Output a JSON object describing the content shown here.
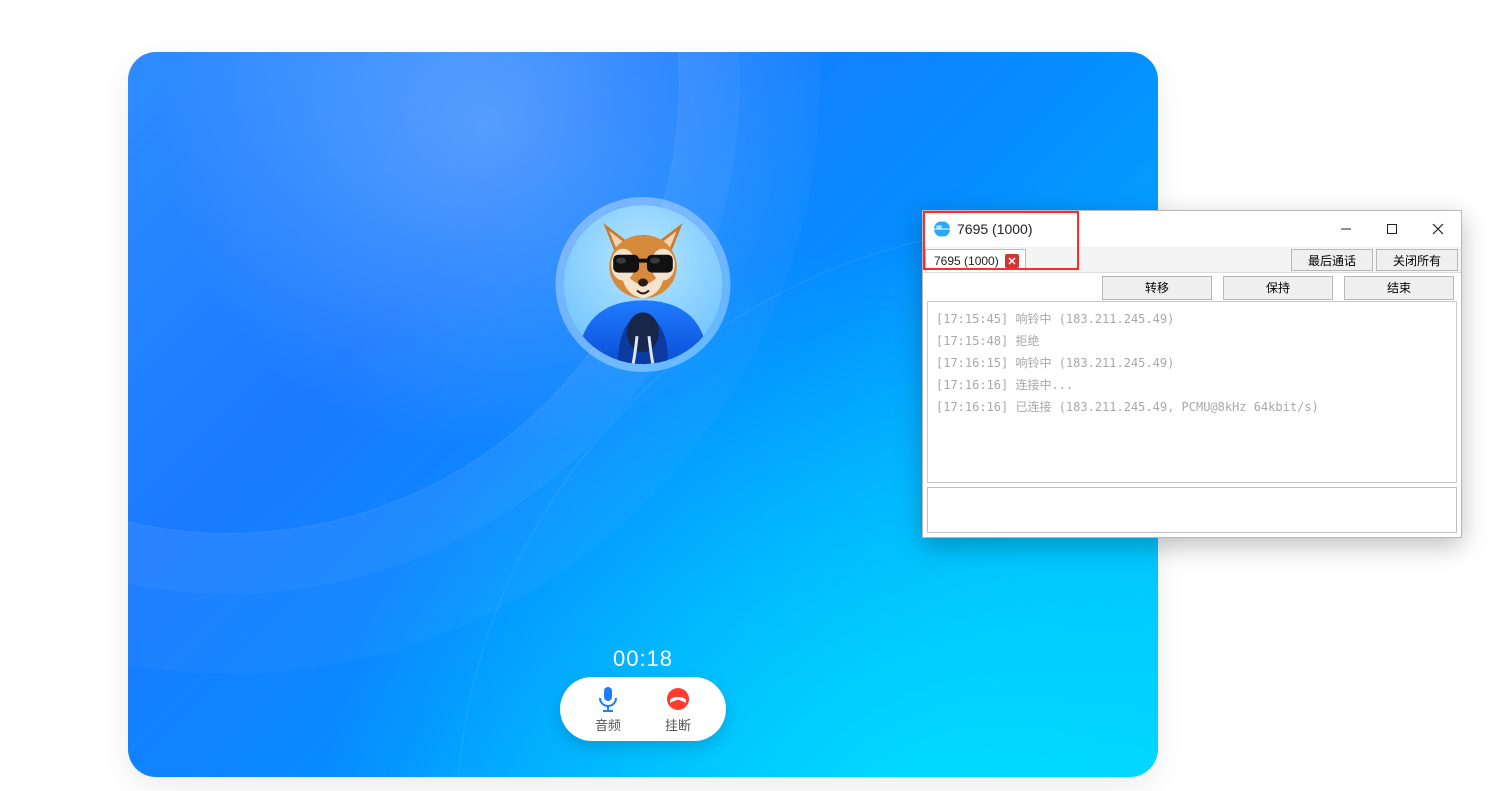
{
  "call": {
    "timer": "00:18",
    "controls": {
      "audio": "音频",
      "hangup": "挂断"
    }
  },
  "dialog": {
    "title": "7695 (1000)",
    "tab": {
      "label": "7695 (1000)"
    },
    "tab_buttons": {
      "last_call": "最后通话",
      "close_all": "关闭所有"
    },
    "action_buttons": {
      "transfer": "转移",
      "hold": "保持",
      "end": "结束"
    },
    "log_lines": [
      "[17:15:45] 响铃中 (183.211.245.49)",
      "[17:15:48] 拒绝",
      "[17:16:15] 响铃中 (183.211.245.49)",
      "[17:16:16] 连接中...",
      "[17:16:16] 已连接 (183.211.245.49, PCMU@8kHz 64kbit/s)"
    ],
    "message_input": ""
  }
}
